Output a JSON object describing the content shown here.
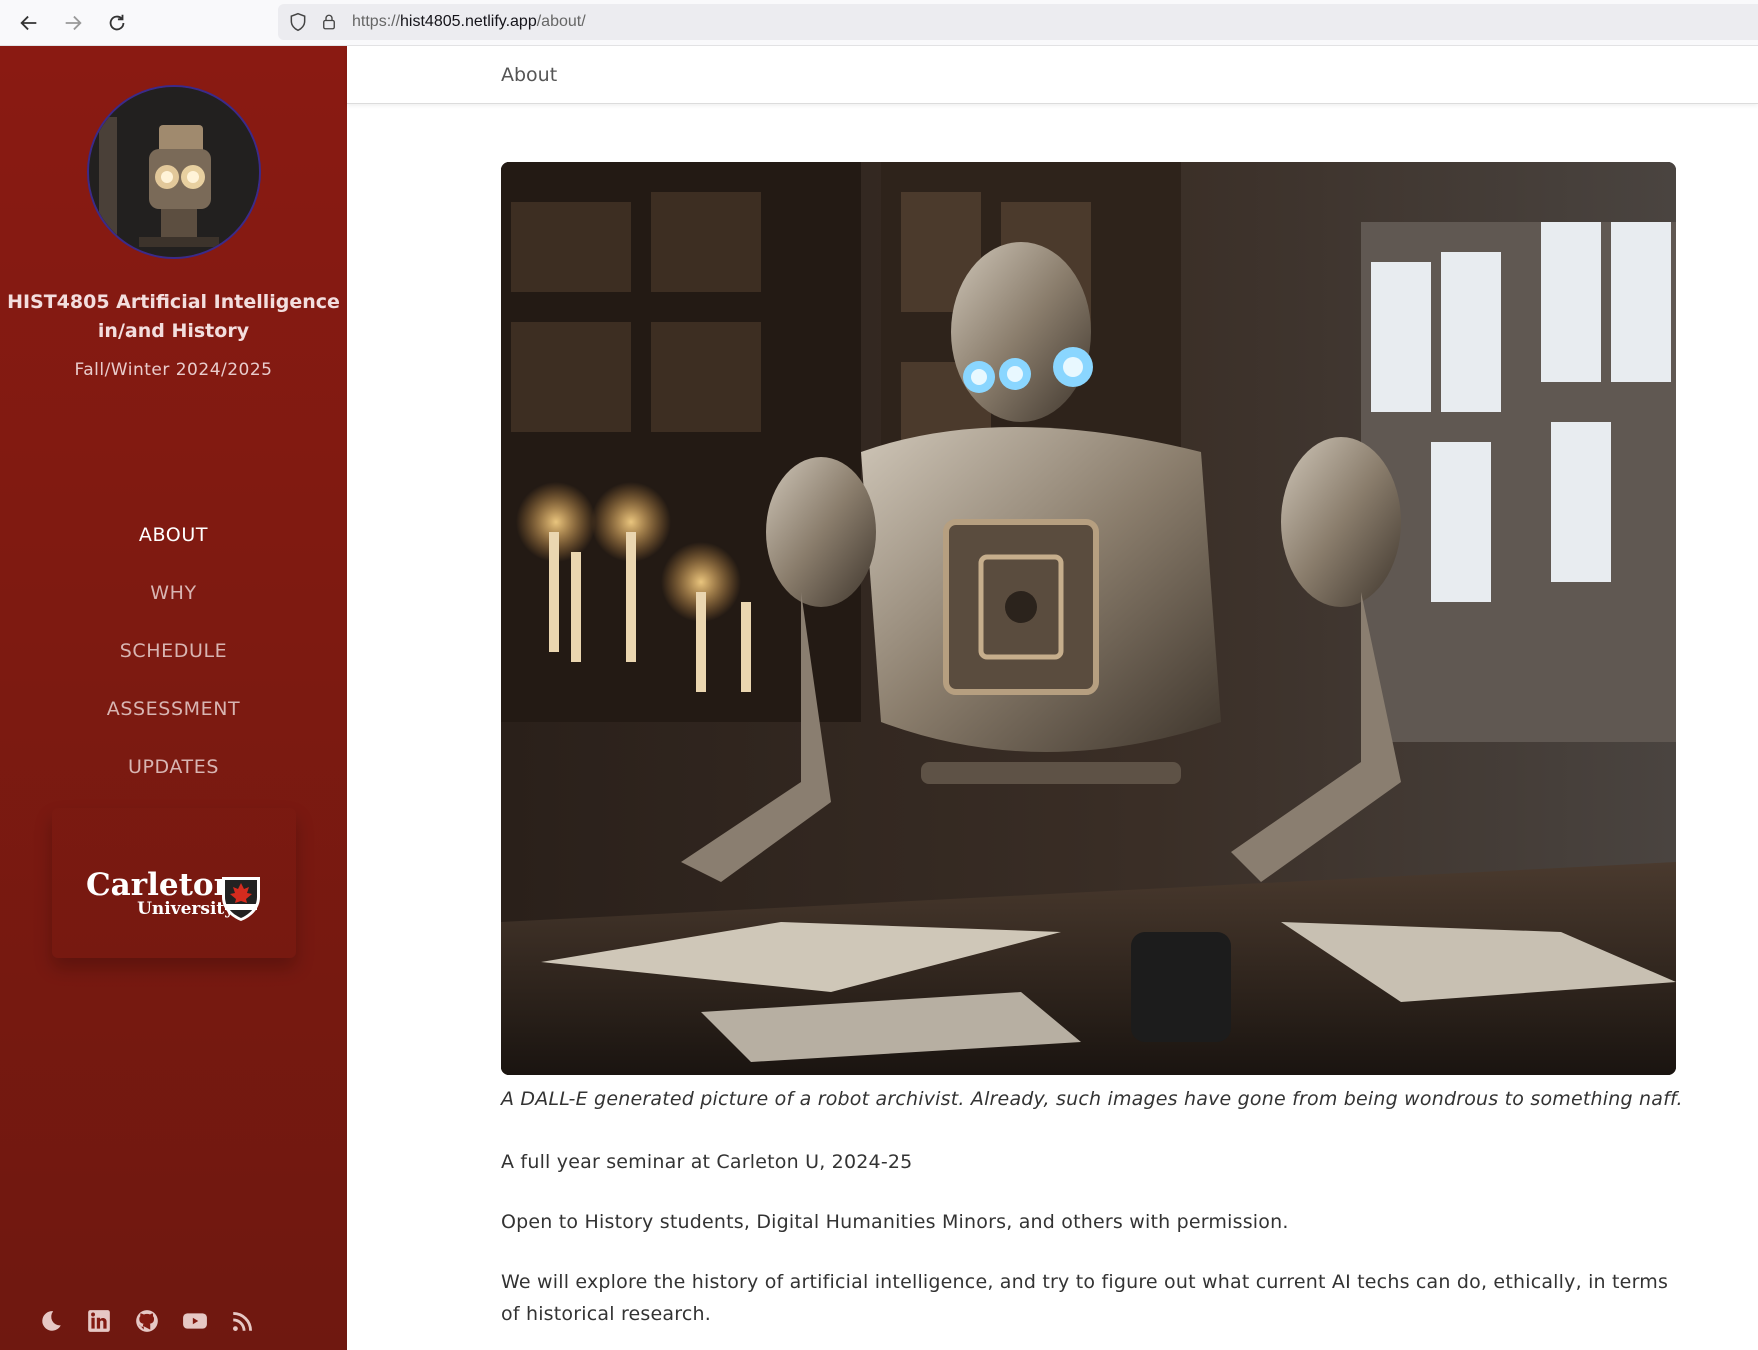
{
  "browser": {
    "url_scheme": "https://",
    "url_host": "hist4805.netlify.app",
    "url_path": "/about/"
  },
  "sidebar": {
    "title": "HIST4805 Artificial Intelligence in/and History",
    "subtitle": "Fall/Winter 2024/2025",
    "menu": [
      {
        "label": "ABOUT",
        "active": true
      },
      {
        "label": "WHY",
        "active": false
      },
      {
        "label": "SCHEDULE",
        "active": false
      },
      {
        "label": "ASSESSMENT",
        "active": false
      },
      {
        "label": "UPDATES",
        "active": false
      }
    ],
    "logo": {
      "main": "Carleton",
      "sub": "University"
    },
    "social_icons": [
      "theme-toggle-icon",
      "linkedin-icon",
      "github-icon",
      "youtube-icon",
      "rss-icon"
    ]
  },
  "main": {
    "breadcrumb": "About",
    "caption": "A DALL-E generated picture of a robot archivist. Already, such images have gone from being wondrous to something naff.",
    "paragraphs": [
      "A full year seminar at Carleton U, 2024-25",
      "Open to History students, Digital Humanities Minors, and others with permission.",
      "We will explore the history of artificial intelligence, and try to figure out what current AI techs can do, ethically, in terms of historical research."
    ]
  },
  "colors": {
    "sidebar": "#821a11",
    "accent_text": "#ffffff"
  }
}
